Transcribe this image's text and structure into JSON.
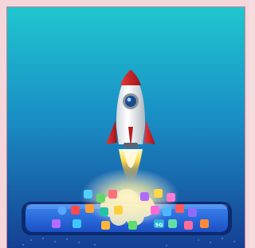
{
  "scene": {
    "background_top": "#1fc3cf",
    "background_bottom": "#163f93",
    "rocket_body": "#ffffff",
    "rocket_fin": "#d4262a",
    "flame": "#ffd54a",
    "phone_screen": "#246de4",
    "icon_badge_text": "5G"
  }
}
